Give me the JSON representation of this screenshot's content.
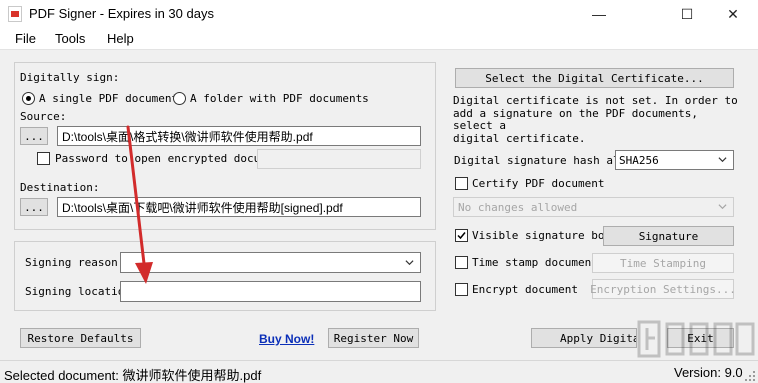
{
  "window": {
    "title": "PDF Signer - Expires in 30 days",
    "minimize": "—",
    "maximize": "☐",
    "close": "✕"
  },
  "menu": [
    "File",
    "Tools",
    "Help"
  ],
  "sign_group": {
    "heading": "Digitally sign:",
    "radio_single": "A single PDF document",
    "radio_folder": "A folder with PDF documents",
    "selected": "single",
    "source_label": "Source:",
    "browse_label": "...",
    "source_path": "D:\\tools\\桌面\\格式转换\\微讲师软件使用帮助.pdf",
    "password_label": "Password to open encrypted document",
    "password_checked": false,
    "destination_label": "Destination:",
    "destination_path": "D:\\tools\\桌面\\下载吧\\微讲师软件使用帮助[signed].pdf"
  },
  "reason_group": {
    "reason_label": "Signing reason:",
    "reason_value": "",
    "location_label": "Signing location:",
    "location_value": ""
  },
  "cert": {
    "select_button": "Select the Digital Certificate...",
    "message": "Digital certificate is not set. In order to add a signature on the PDF documents, select a digital certificate.",
    "message_lines": [
      "Digital certificate is not set. In order to",
      "add a signature on the PDF documents, select a",
      "digital certificate."
    ],
    "hash_label": "Digital signature hash algorithm:",
    "hash_value": "SHA256",
    "certify_label": "Certify PDF document",
    "certify_checked": false,
    "certify_value": "No changes allowed",
    "visible_label": "Visible signature box",
    "visible_checked": true,
    "signature_button": "Signature",
    "timestamp_label": "Time stamp document",
    "timestamp_checked": false,
    "timestamp_button": "Time Stamping",
    "encrypt_label": "Encrypt document",
    "encrypt_checked": false,
    "encrypt_button": "Encryption Settings..."
  },
  "bottom": {
    "restore": "Restore Defaults",
    "buy": "Buy Now!",
    "register": "Register Now",
    "apply": "Apply Digital Signature",
    "exit": "Exit"
  },
  "status": {
    "selected_doc": "Selected document: 微讲师软件使用帮助.pdf",
    "version": "Version: 9.0"
  },
  "colors": {
    "annotation_arrow": "#d22b2b",
    "link": "#0b2fb8"
  }
}
